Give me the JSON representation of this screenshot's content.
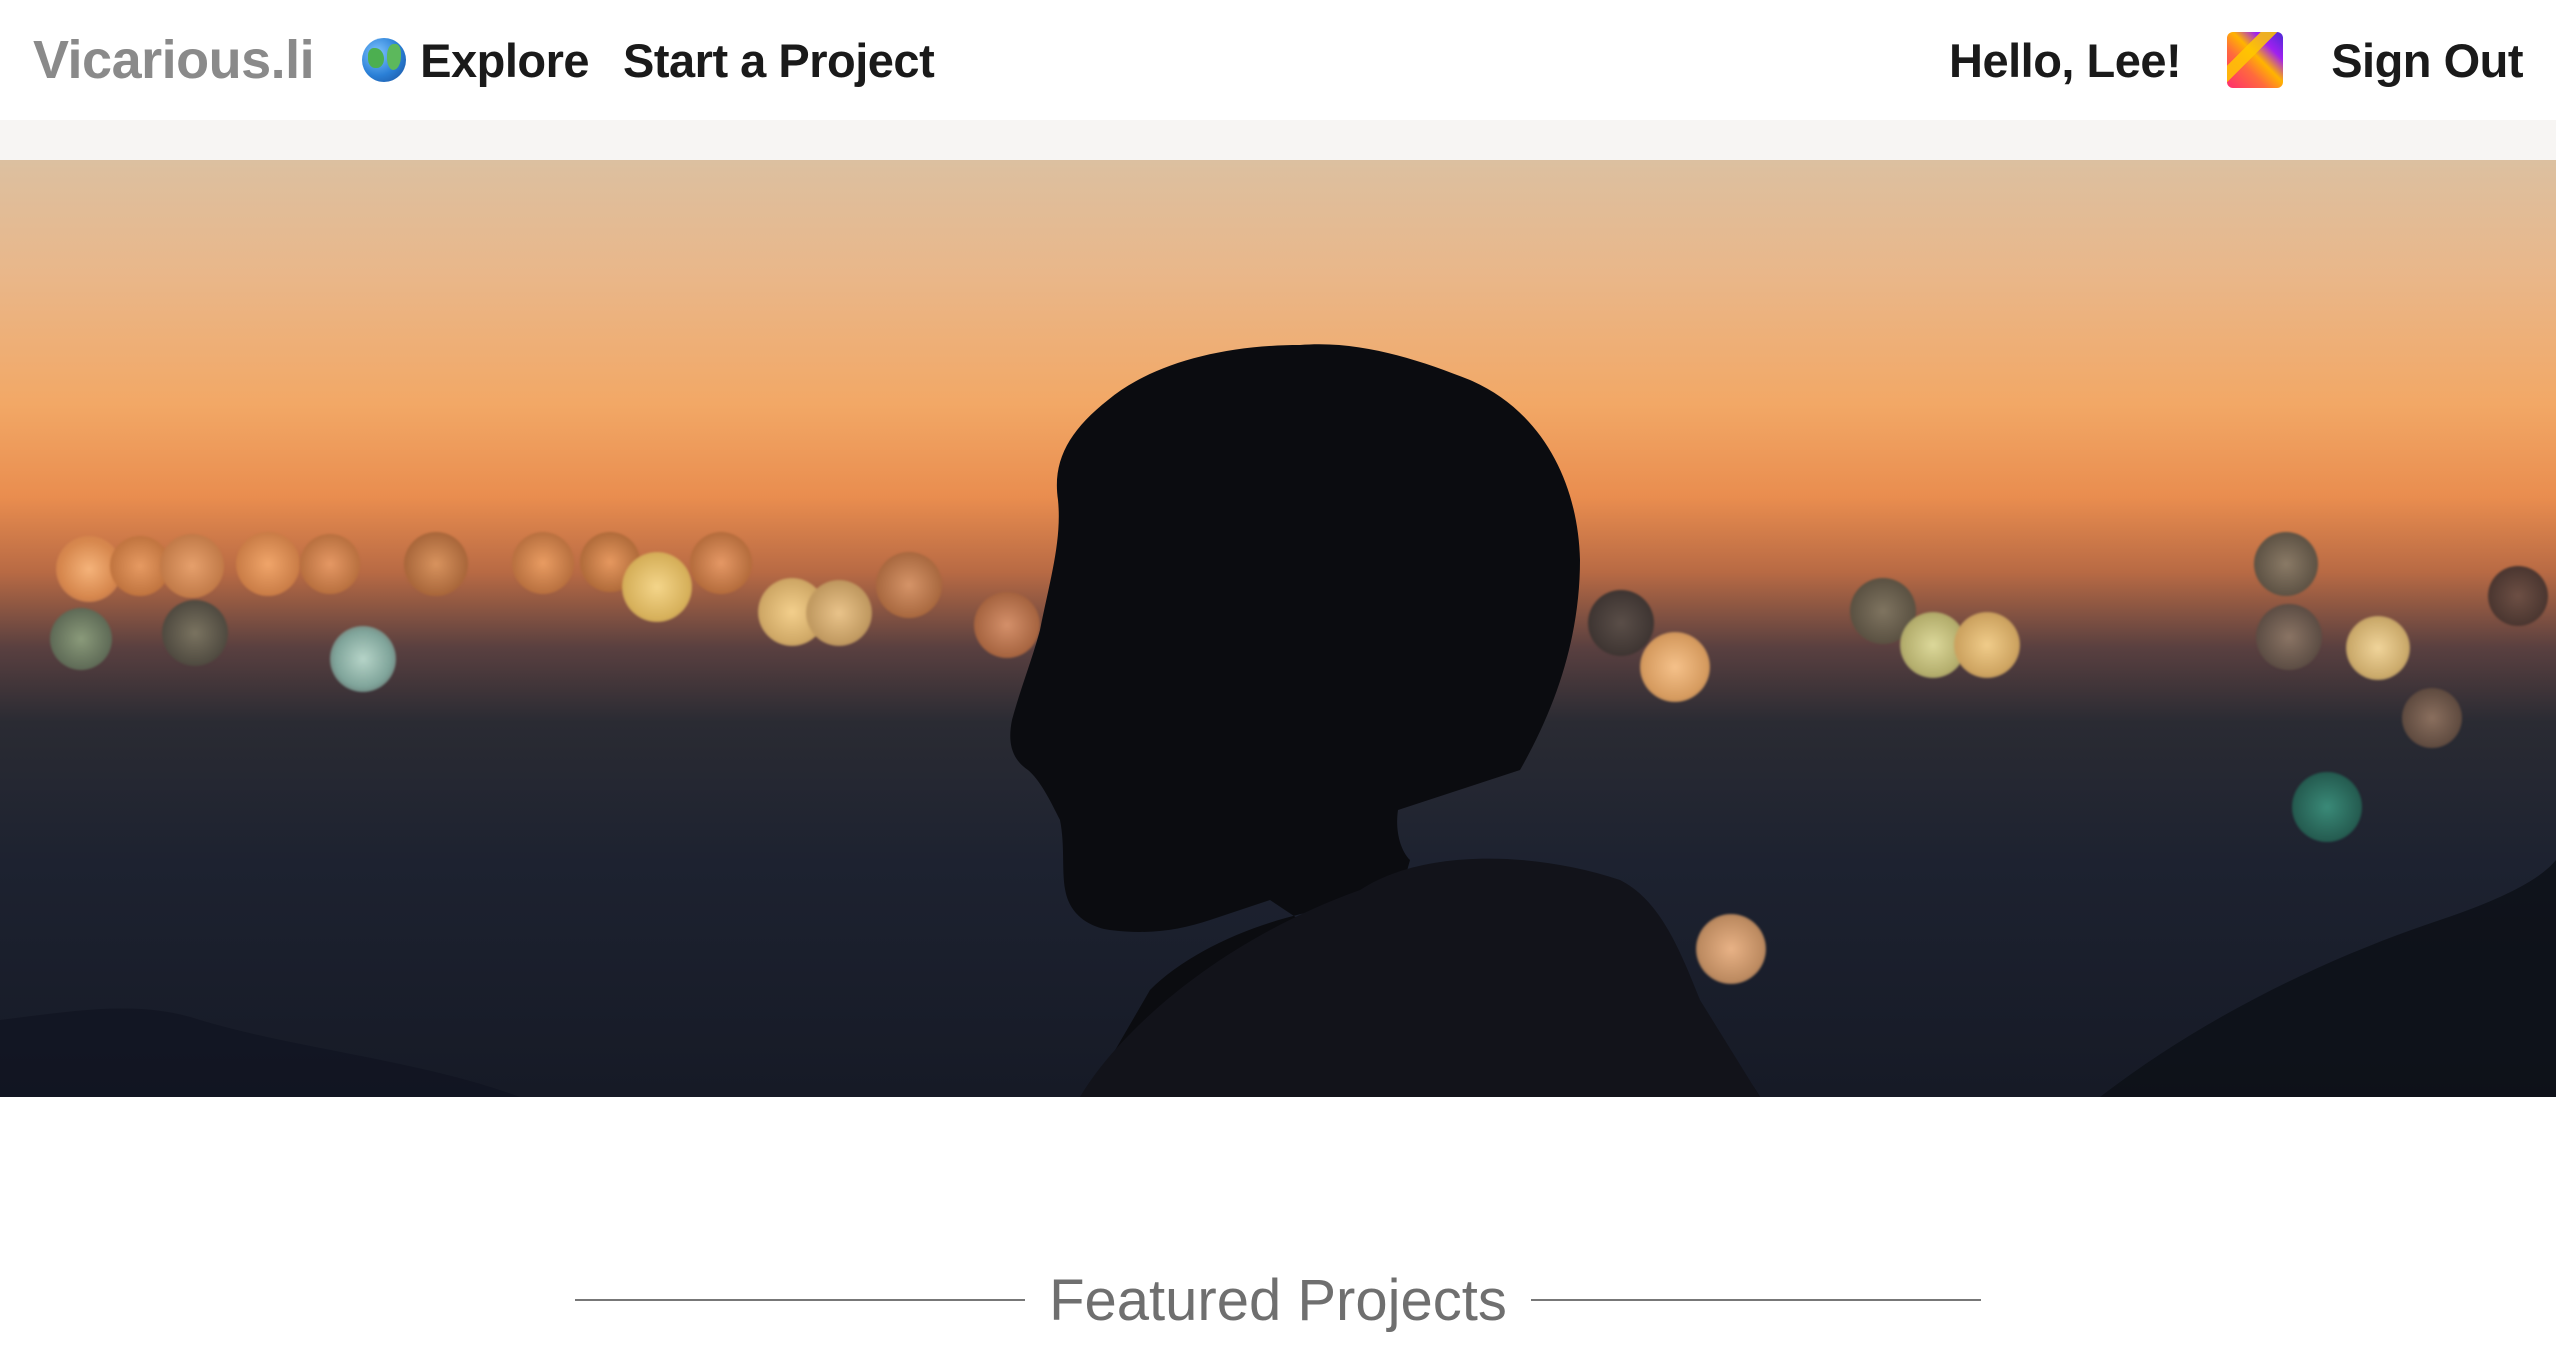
{
  "nav": {
    "brand": "Vicarious.li",
    "explore_label": "Explore",
    "start_project_label": "Start a Project",
    "greeting": "Hello, Lee!",
    "signout_label": "Sign Out"
  },
  "hero": {
    "image": "silhouette-of-man-at-dusk-over-city-bokeh"
  },
  "featured": {
    "title": "Featured Projects"
  },
  "icons": {
    "explore": "globe-icon",
    "avatar": "user-avatar"
  },
  "colors": {
    "brand_text": "#8a8a8a",
    "nav_text": "#1a1a1a",
    "section_title": "#6f6f6f"
  }
}
